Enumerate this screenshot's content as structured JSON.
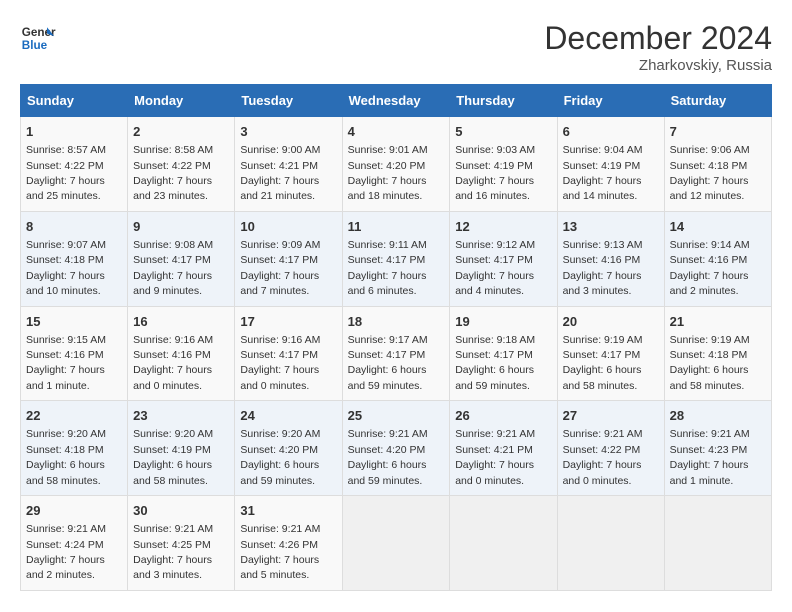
{
  "header": {
    "logo_general": "General",
    "logo_blue": "Blue",
    "month_title": "December 2024",
    "location": "Zharkovskiy, Russia"
  },
  "days_of_week": [
    "Sunday",
    "Monday",
    "Tuesday",
    "Wednesday",
    "Thursday",
    "Friday",
    "Saturday"
  ],
  "weeks": [
    [
      {
        "day": "1",
        "sunrise": "8:57 AM",
        "sunset": "4:22 PM",
        "daylight": "7 hours and 25 minutes."
      },
      {
        "day": "2",
        "sunrise": "8:58 AM",
        "sunset": "4:22 PM",
        "daylight": "7 hours and 23 minutes."
      },
      {
        "day": "3",
        "sunrise": "9:00 AM",
        "sunset": "4:21 PM",
        "daylight": "7 hours and 21 minutes."
      },
      {
        "day": "4",
        "sunrise": "9:01 AM",
        "sunset": "4:20 PM",
        "daylight": "7 hours and 18 minutes."
      },
      {
        "day": "5",
        "sunrise": "9:03 AM",
        "sunset": "4:19 PM",
        "daylight": "7 hours and 16 minutes."
      },
      {
        "day": "6",
        "sunrise": "9:04 AM",
        "sunset": "4:19 PM",
        "daylight": "7 hours and 14 minutes."
      },
      {
        "day": "7",
        "sunrise": "9:06 AM",
        "sunset": "4:18 PM",
        "daylight": "7 hours and 12 minutes."
      }
    ],
    [
      {
        "day": "8",
        "sunrise": "9:07 AM",
        "sunset": "4:18 PM",
        "daylight": "7 hours and 10 minutes."
      },
      {
        "day": "9",
        "sunrise": "9:08 AM",
        "sunset": "4:17 PM",
        "daylight": "7 hours and 9 minutes."
      },
      {
        "day": "10",
        "sunrise": "9:09 AM",
        "sunset": "4:17 PM",
        "daylight": "7 hours and 7 minutes."
      },
      {
        "day": "11",
        "sunrise": "9:11 AM",
        "sunset": "4:17 PM",
        "daylight": "7 hours and 6 minutes."
      },
      {
        "day": "12",
        "sunrise": "9:12 AM",
        "sunset": "4:17 PM",
        "daylight": "7 hours and 4 minutes."
      },
      {
        "day": "13",
        "sunrise": "9:13 AM",
        "sunset": "4:16 PM",
        "daylight": "7 hours and 3 minutes."
      },
      {
        "day": "14",
        "sunrise": "9:14 AM",
        "sunset": "4:16 PM",
        "daylight": "7 hours and 2 minutes."
      }
    ],
    [
      {
        "day": "15",
        "sunrise": "9:15 AM",
        "sunset": "4:16 PM",
        "daylight": "7 hours and 1 minute."
      },
      {
        "day": "16",
        "sunrise": "9:16 AM",
        "sunset": "4:16 PM",
        "daylight": "7 hours and 0 minutes."
      },
      {
        "day": "17",
        "sunrise": "9:16 AM",
        "sunset": "4:17 PM",
        "daylight": "7 hours and 0 minutes."
      },
      {
        "day": "18",
        "sunrise": "9:17 AM",
        "sunset": "4:17 PM",
        "daylight": "6 hours and 59 minutes."
      },
      {
        "day": "19",
        "sunrise": "9:18 AM",
        "sunset": "4:17 PM",
        "daylight": "6 hours and 59 minutes."
      },
      {
        "day": "20",
        "sunrise": "9:19 AM",
        "sunset": "4:17 PM",
        "daylight": "6 hours and 58 minutes."
      },
      {
        "day": "21",
        "sunrise": "9:19 AM",
        "sunset": "4:18 PM",
        "daylight": "6 hours and 58 minutes."
      }
    ],
    [
      {
        "day": "22",
        "sunrise": "9:20 AM",
        "sunset": "4:18 PM",
        "daylight": "6 hours and 58 minutes."
      },
      {
        "day": "23",
        "sunrise": "9:20 AM",
        "sunset": "4:19 PM",
        "daylight": "6 hours and 58 minutes."
      },
      {
        "day": "24",
        "sunrise": "9:20 AM",
        "sunset": "4:20 PM",
        "daylight": "6 hours and 59 minutes."
      },
      {
        "day": "25",
        "sunrise": "9:21 AM",
        "sunset": "4:20 PM",
        "daylight": "6 hours and 59 minutes."
      },
      {
        "day": "26",
        "sunrise": "9:21 AM",
        "sunset": "4:21 PM",
        "daylight": "7 hours and 0 minutes."
      },
      {
        "day": "27",
        "sunrise": "9:21 AM",
        "sunset": "4:22 PM",
        "daylight": "7 hours and 0 minutes."
      },
      {
        "day": "28",
        "sunrise": "9:21 AM",
        "sunset": "4:23 PM",
        "daylight": "7 hours and 1 minute."
      }
    ],
    [
      {
        "day": "29",
        "sunrise": "9:21 AM",
        "sunset": "4:24 PM",
        "daylight": "7 hours and 2 minutes."
      },
      {
        "day": "30",
        "sunrise": "9:21 AM",
        "sunset": "4:25 PM",
        "daylight": "7 hours and 3 minutes."
      },
      {
        "day": "31",
        "sunrise": "9:21 AM",
        "sunset": "4:26 PM",
        "daylight": "7 hours and 5 minutes."
      },
      null,
      null,
      null,
      null
    ]
  ]
}
